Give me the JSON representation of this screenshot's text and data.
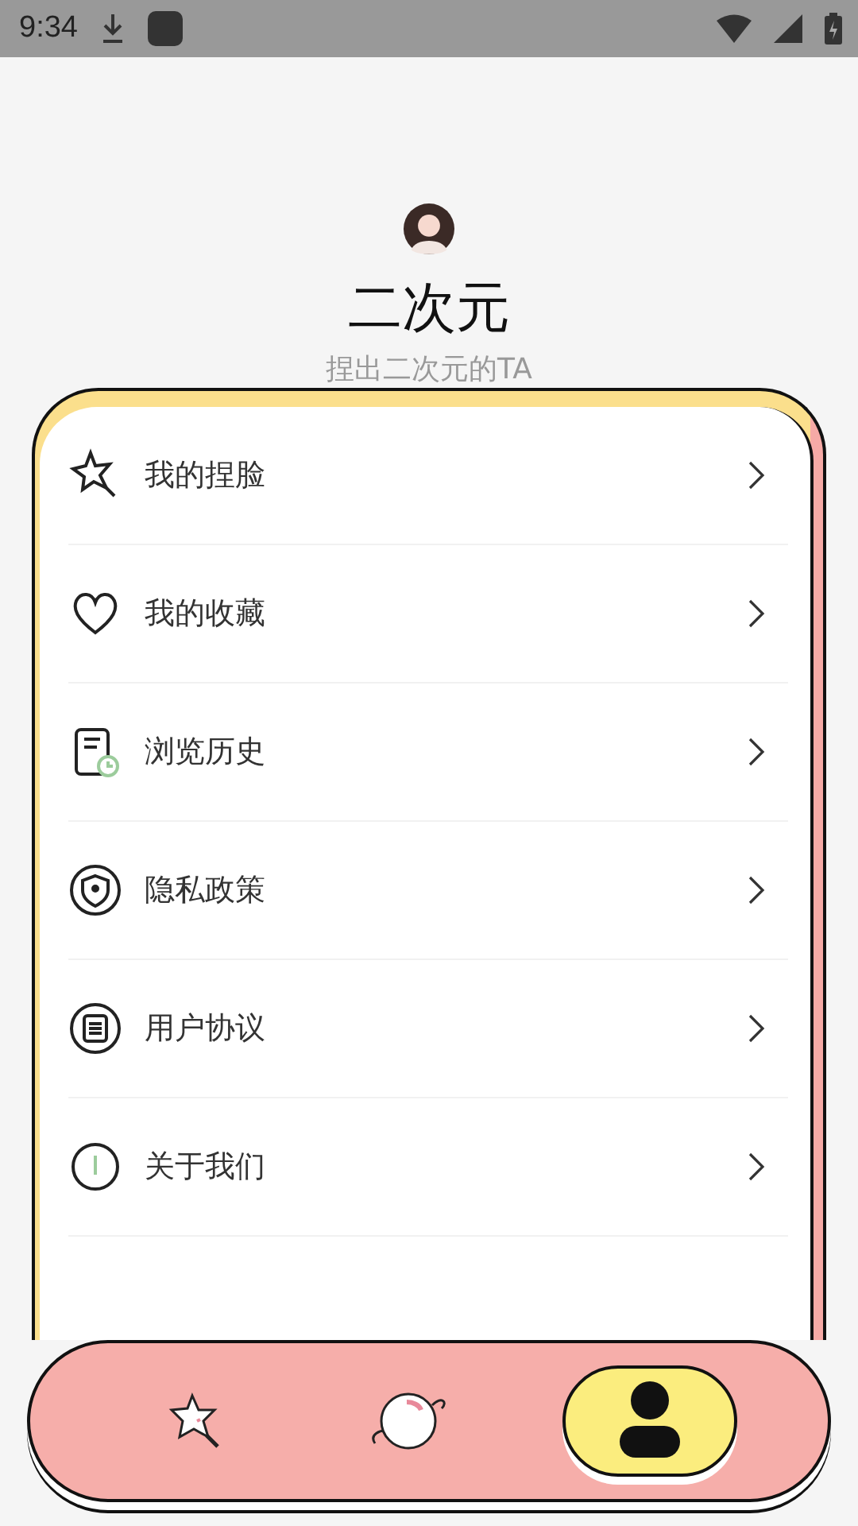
{
  "status_bar": {
    "time": "9:34"
  },
  "profile": {
    "name": "二次元",
    "subtitle": "捏出二次元的TA"
  },
  "menu": [
    {
      "label": "我的捏脸"
    },
    {
      "label": "我的收藏"
    },
    {
      "label": "浏览历史"
    },
    {
      "label": "隐私政策"
    },
    {
      "label": "用户协议"
    },
    {
      "label": "关于我们"
    }
  ],
  "tabs": [
    {
      "selected": false
    },
    {
      "selected": false
    },
    {
      "selected": true
    }
  ]
}
